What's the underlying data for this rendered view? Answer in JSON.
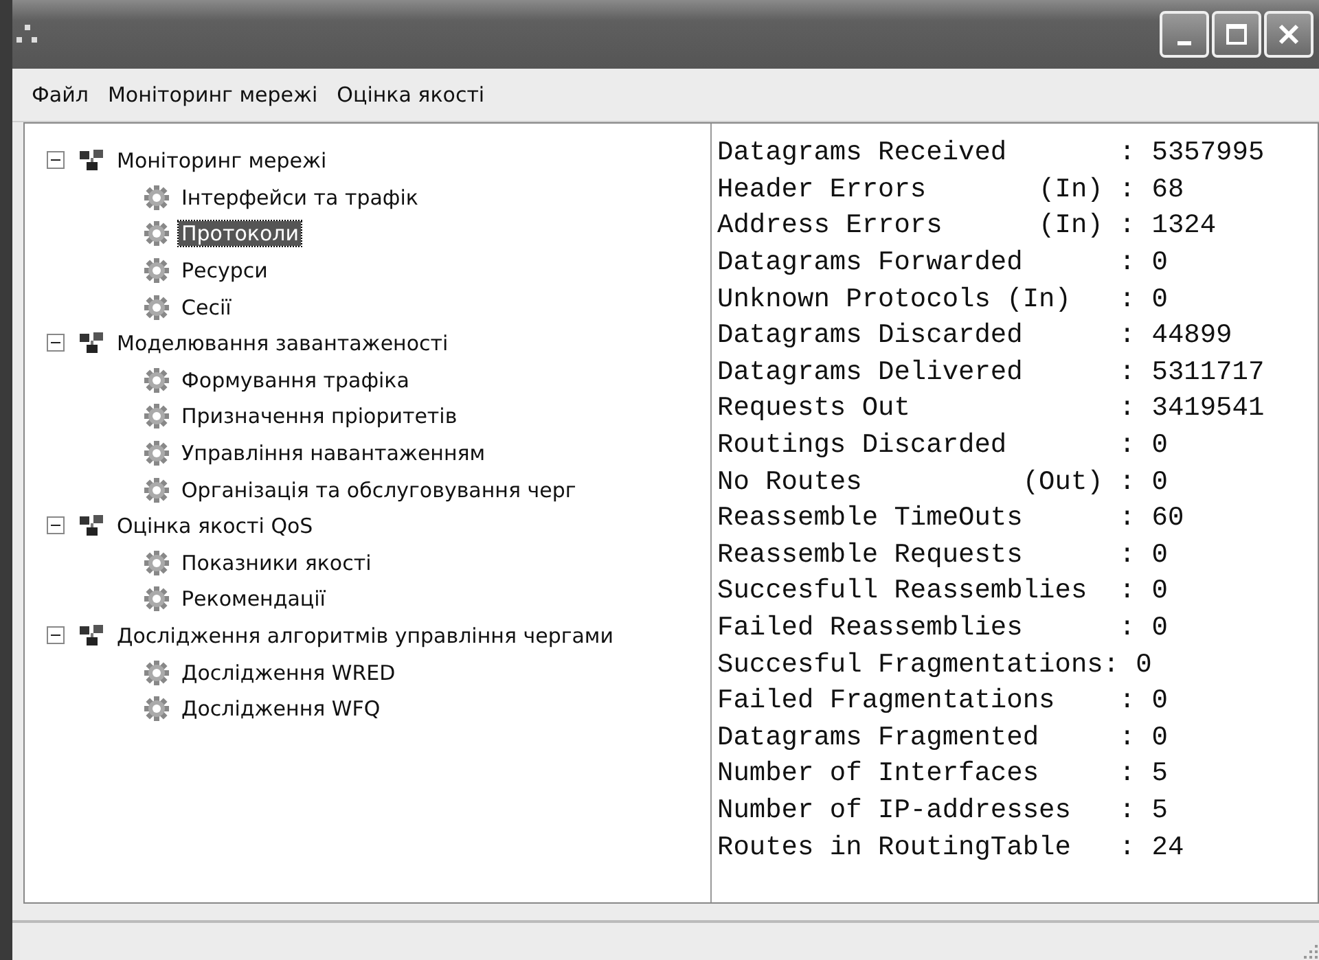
{
  "menu": [
    "Файл",
    "Моніторинг мережі",
    "Оцінка якості"
  ],
  "tree": [
    {
      "label": "Моніторинг мережі",
      "expanded": true,
      "selected": false,
      "children": [
        {
          "label": "Інтерфейси та трафік",
          "selected": false
        },
        {
          "label": "Протоколи",
          "selected": true
        },
        {
          "label": "Ресурси",
          "selected": false
        },
        {
          "label": "Сесії",
          "selected": false
        }
      ]
    },
    {
      "label": "Моделювання завантаженості",
      "expanded": true,
      "selected": false,
      "children": [
        {
          "label": "Формування трафіка",
          "selected": false
        },
        {
          "label": "Призначення пріоритетів",
          "selected": false
        },
        {
          "label": "Управління навантаженням",
          "selected": false
        },
        {
          "label": "Організація та обслуговування черг",
          "selected": false
        }
      ]
    },
    {
      "label": "Оцінка якості QoS",
      "expanded": true,
      "selected": false,
      "children": [
        {
          "label": "Показники якості",
          "selected": false
        },
        {
          "label": "Рекомендації",
          "selected": false
        }
      ]
    },
    {
      "label": "Дослідження алгоритмів управління чергами",
      "expanded": true,
      "selected": false,
      "children": [
        {
          "label": "Дослідження WRED",
          "selected": false
        },
        {
          "label": "Дослідження WFQ",
          "selected": false
        }
      ]
    }
  ],
  "stats": [
    {
      "label": "Datagrams Received       :",
      "value": "5357995"
    },
    {
      "label": "Header Errors       (In) :",
      "value": "68"
    },
    {
      "label": "Address Errors      (In) :",
      "value": "1324"
    },
    {
      "label": "Datagrams Forwarded      :",
      "value": "0"
    },
    {
      "label": "Unknown Protocols (In)   :",
      "value": "0"
    },
    {
      "label": "Datagrams Discarded      :",
      "value": "44899"
    },
    {
      "label": "Datagrams Delivered      :",
      "value": "5311717"
    },
    {
      "label": "Requests Out             :",
      "value": "3419541"
    },
    {
      "label": "Routings Discarded       :",
      "value": "0"
    },
    {
      "label": "No Routes          (Out) :",
      "value": "0"
    },
    {
      "label": "Reassemble TimeOuts      :",
      "value": "60"
    },
    {
      "label": "Reassemble Requests      :",
      "value": "0"
    },
    {
      "label": "Succesfull Reassemblies  :",
      "value": "0"
    },
    {
      "label": "Failed Reassemblies      :",
      "value": "0"
    },
    {
      "label": "Succesful Fragmentations:",
      "value": "0"
    },
    {
      "label": "Failed Fragmentations    :",
      "value": "0"
    },
    {
      "label": "Datagrams Fragmented     :",
      "value": "0"
    },
    {
      "label": "Number of Interfaces     :",
      "value": "5"
    },
    {
      "label": "Number of IP-addresses   :",
      "value": "5"
    },
    {
      "label": "Routes in RoutingTable   :",
      "value": "24"
    }
  ]
}
